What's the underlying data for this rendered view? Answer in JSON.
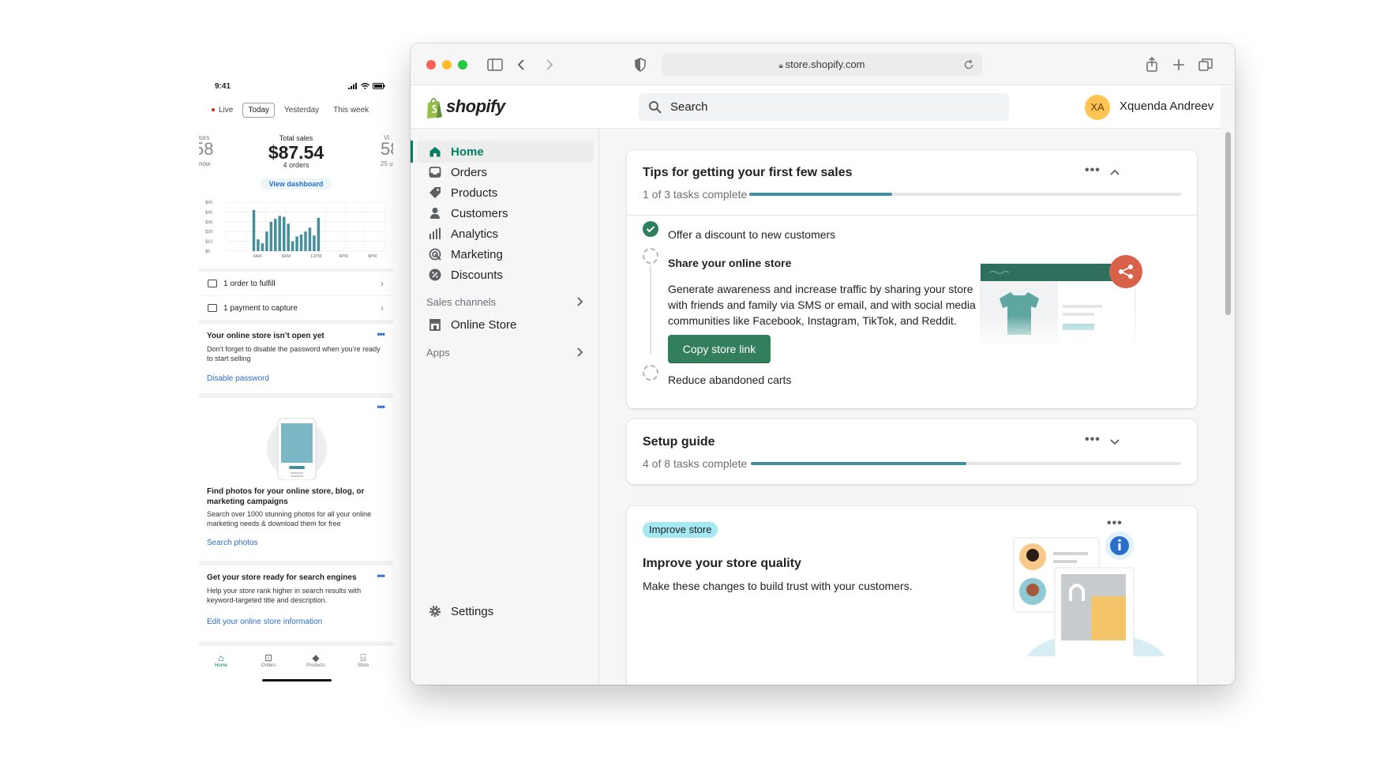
{
  "phone": {
    "time": "9:41",
    "tabs": [
      {
        "label": "Live"
      },
      {
        "label": "Today"
      },
      {
        "label": "Yesterday"
      },
      {
        "label": "This week"
      }
    ],
    "left_partial": {
      "label": "tors",
      "value": "58",
      "sub": "now"
    },
    "right_partial": {
      "label": "Vi",
      "value": "58",
      "sub": "25 u"
    },
    "total_sales_label": "Total sales",
    "total_sales": "$87.54",
    "orders": "4 orders",
    "view_dashboard": "View dashboard",
    "chart_data": {
      "type": "bar",
      "y_ticks": [
        "$50",
        "$40",
        "$30",
        "$20",
        "$10",
        "$0"
      ],
      "x_ticks": [
        "4AM",
        "8AM",
        "12PM",
        "4PM",
        "8PM"
      ],
      "ylim": [
        0,
        50
      ],
      "values": [
        0,
        0,
        0,
        0,
        0,
        0,
        42,
        12,
        8,
        20,
        30,
        33,
        36,
        35,
        28,
        10,
        15,
        17,
        20,
        24,
        16,
        34,
        0,
        0,
        0,
        0,
        0,
        0,
        0,
        0,
        0,
        0,
        0,
        0,
        0,
        0,
        0
      ],
      "color": "#458f9c"
    },
    "rows": [
      {
        "label": "1 order to fulfill"
      },
      {
        "label": "1 payment to capture"
      }
    ],
    "card_store": {
      "title": "Your online store isn’t open yet",
      "text": "Don’t forget to disable the password when you’re ready to start selling",
      "link": "Disable password"
    },
    "card_photos": {
      "title": "Find photos for your online store, blog, or marketing campaigns",
      "text": "Search over 1000 stunning photos for all your online marketing needs & download them for free",
      "link": "Search photos"
    },
    "card_seo": {
      "title": "Get your store ready for search engines",
      "text": "Help your store rank higher in search results with keyword-targeted title and description.",
      "link": "Edit your online store information"
    },
    "nav": [
      {
        "label": "Home"
      },
      {
        "label": "Orders"
      },
      {
        "label": "Products"
      },
      {
        "label": "Store"
      }
    ]
  },
  "browser": {
    "url": "store.shopify.com"
  },
  "app": {
    "logo_text": "shopify",
    "search_placeholder": "Search",
    "user": {
      "initials": "XA",
      "name": "Xquenda Andreev"
    },
    "sidebar": {
      "items": [
        {
          "label": "Home",
          "icon": "home-icon"
        },
        {
          "label": "Orders",
          "icon": "orders-icon"
        },
        {
          "label": "Products",
          "icon": "tag-icon"
        },
        {
          "label": "Customers",
          "icon": "person-icon"
        },
        {
          "label": "Analytics",
          "icon": "bar-chart-icon"
        },
        {
          "label": "Marketing",
          "icon": "target-icon"
        },
        {
          "label": "Discounts",
          "icon": "discount-icon"
        }
      ],
      "sales_channels_label": "Sales channels",
      "online_store": "Online Store",
      "apps_label": "Apps",
      "settings": "Settings"
    },
    "tips_card": {
      "title": "Tips for getting your first few sales",
      "progress_text": "1 of 3 tasks complete",
      "progress": 0.33,
      "task1": "Offer a discount to new customers",
      "task2_title": "Share your online store",
      "task2_desc": "Generate awareness and increase traffic by sharing your store with friends and family via SMS or email, and with social media communities like Facebook, Instagram, TikTok, and Reddit.",
      "task2_button": "Copy store link",
      "task3": "Reduce abandoned carts"
    },
    "setup_card": {
      "title": "Setup guide",
      "progress_text": "4 of 8 tasks complete",
      "progress": 0.5
    },
    "improve_card": {
      "badge": "Improve store",
      "title": "Improve your store quality",
      "text": "Make these changes to build trust with your customers."
    },
    "colors": {
      "brand_green": "#008060",
      "button_green": "#337e5c",
      "progress_fill": "#458f9c",
      "badge_bg": "#a4e8f2",
      "share_red": "#d9614a"
    }
  }
}
